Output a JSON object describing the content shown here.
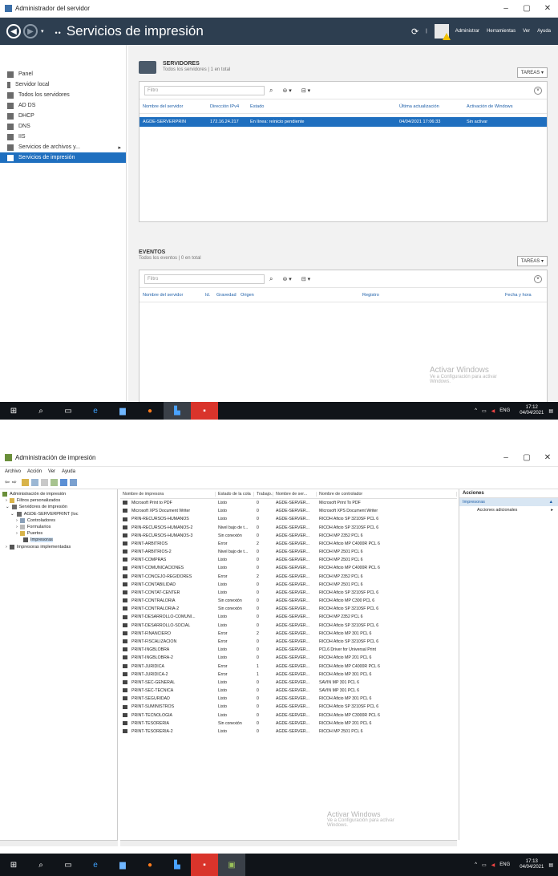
{
  "sm": {
    "window_title": "Administrador del servidor",
    "header_title": "Servicios de impresión",
    "menus": [
      "Administrar",
      "Herramientas",
      "Ver",
      "Ayuda"
    ],
    "sidebar": [
      {
        "label": "Panel",
        "selected": false
      },
      {
        "label": "Servidor local",
        "selected": false
      },
      {
        "label": "Todos los servidores",
        "selected": false
      },
      {
        "label": "AD DS",
        "selected": false
      },
      {
        "label": "DHCP",
        "selected": false
      },
      {
        "label": "DNS",
        "selected": false
      },
      {
        "label": "IIS",
        "selected": false
      },
      {
        "label": "Servicios de archivos y...",
        "selected": false,
        "arrow": "▸"
      },
      {
        "label": "Servicios de impresión",
        "selected": true
      }
    ],
    "servers": {
      "title": "SERVIDORES",
      "subtitle": "Todos los servidores | 1 en total",
      "tasks": "TAREAS",
      "filter_placeholder": "Filtro",
      "columns": [
        "Nombre del servidor",
        "Dirección IPv4",
        "Estado",
        "Última actualización",
        "Activación de Windows"
      ],
      "row": [
        "AGDE-SERVERPRIN",
        "172.16.24.217",
        "En línea: reinicio pendiente",
        "04/04/2021 17:06:33",
        "Sin activar"
      ]
    },
    "events": {
      "title": "EVENTOS",
      "subtitle": "Todos los eventos | 0 en total",
      "tasks": "TAREAS",
      "filter_placeholder": "Filtro",
      "columns": [
        "Nombre del servidor",
        "Id.",
        "Gravedad",
        "Origen",
        "Registro",
        "Fecha y hora"
      ]
    },
    "watermark": {
      "line1": "Activar Windows",
      "line2": "Ve a Configuración para activar",
      "line3": "Windows."
    }
  },
  "taskbar1": {
    "lang": "ENG",
    "time": "17:12",
    "date": "04/04/2021"
  },
  "pm": {
    "window_title": "Administración de impresión",
    "menus": [
      "Archivo",
      "Acción",
      "Ver",
      "Ayuda"
    ],
    "tree": [
      {
        "label": "Administración de impresión",
        "indent": 0
      },
      {
        "label": "Filtros personalizados",
        "indent": 1
      },
      {
        "label": "Servidores de impresión",
        "indent": 1
      },
      {
        "label": "AGDE-SERVERPRINT (loc",
        "indent": 2
      },
      {
        "label": "Controladores",
        "indent": 3
      },
      {
        "label": "Formularios",
        "indent": 3
      },
      {
        "label": "Puertos",
        "indent": 3
      },
      {
        "label": "Impresoras",
        "indent": 3,
        "selected": true
      },
      {
        "label": "Impresoras implementadas",
        "indent": 1
      }
    ],
    "columns": [
      "Nombre de impresora",
      "Estado de la cola",
      "Trabajo...",
      "Nombre de ser...",
      "Nombre de controlador"
    ],
    "printers": [
      [
        "Microsoft Print to PDF",
        "Listo",
        "0",
        "AGDE-SERVER...",
        "Microsoft Print To PDF"
      ],
      [
        "Microsoft XPS Document Writer",
        "Listo",
        "0",
        "AGDE-SERVER...",
        "Microsoft XPS Document Writer"
      ],
      [
        "PRIN-RECURSOS-HUMANOS",
        "Listo",
        "0",
        "AGDE-SERVER...",
        "RICOH Aficio SP 3210SF PCL 6"
      ],
      [
        "PRIN-RECURSOS-HUMANOS-2",
        "Nivel bajo de t...",
        "0",
        "AGDE-SERVER...",
        "RICOH Aficio SP 3210SF PCL 6"
      ],
      [
        "PRIN-RECURSOS-HUMANOS-3",
        "Sin conexión",
        "0",
        "AGDE-SERVER...",
        "RICOH MP 2352 PCL 6"
      ],
      [
        "PRINT-ARBITRIOS",
        "Error",
        "2",
        "AGDE-SERVER...",
        "RICOH Aficio MP C4000R PCL 6"
      ],
      [
        "PRINT-ARBITRIOS-2",
        "Nivel bajo de t...",
        "0",
        "AGDE-SERVER...",
        "RICOH MP 2501 PCL 6"
      ],
      [
        "PRINT-COMPRAS",
        "Listo",
        "0",
        "AGDE-SERVER...",
        "RICOH MP 2501 PCL 6"
      ],
      [
        "PRINT-COMUNICACIONES",
        "Listo",
        "0",
        "AGDE-SERVER...",
        "RICOH Aficio MP C4000R PCL 6"
      ],
      [
        "PRINT-CONCEJO-REGIDORES",
        "Error",
        "2",
        "AGDE-SERVER...",
        "RICOH MP 2352 PCL 6"
      ],
      [
        "PRINT-CONTABILIDAD",
        "Listo",
        "0",
        "AGDE-SERVER...",
        "RICOH MP 2501 PCL 6"
      ],
      [
        "PRINT-CONTAT-CENTER",
        "Listo",
        "0",
        "AGDE-SERVER...",
        "RICOH Aficio SP 3210SF PCL 6"
      ],
      [
        "PRINT-CONTRALORIA",
        "Sin conexión",
        "0",
        "AGDE-SERVER...",
        "RICOH Aficio MP C300 PCL 6"
      ],
      [
        "PRINT-CONTRALORIA-2",
        "Sin conexión",
        "0",
        "AGDE-SERVER...",
        "RICOH Aficio SP 3210SF PCL 6"
      ],
      [
        "PRINT-DESARROLLO-COMUNI...",
        "Listo",
        "0",
        "AGDE-SERVER...",
        "RICOH MP 2352 PCL 6"
      ],
      [
        "PRINT-DESARROLLO-SOCIAL",
        "Listo",
        "0",
        "AGDE-SERVER...",
        "RICOH Aficio SP 3210SF PCL 6"
      ],
      [
        "PRINT-FINANCIERO",
        "Error",
        "2",
        "AGDE-SERVER...",
        "RICOH Aficio MP 301 PCL 6"
      ],
      [
        "PRINT-FISCALIZACION",
        "Error",
        "0",
        "AGDE-SERVER...",
        "RICOH Aficio SP 3210SF PCL 6"
      ],
      [
        "PRINT-INGBLOBRA",
        "Listo",
        "0",
        "AGDE-SERVER...",
        "PCL6 Driver for Universal Print"
      ],
      [
        "PRINT-INGBLOBRA-2",
        "Listo",
        "0",
        "AGDE-SERVER...",
        "RICOH Aficio MP 201 PCL 6"
      ],
      [
        "PRINT-JURIDICA",
        "Error",
        "1",
        "AGDE-SERVER...",
        "RICOH Aficio MP C4000R PCL 6"
      ],
      [
        "PRINT-JURIDICA-2",
        "Error",
        "1",
        "AGDE-SERVER...",
        "RICOH Aficio MP 301 PCL 6"
      ],
      [
        "PRINT-SEC-GENERAL",
        "Listo",
        "0",
        "AGDE-SERVER...",
        "SAVIN MP 301 PCL 6"
      ],
      [
        "PRINT-SEC-TECNICA",
        "Listo",
        "0",
        "AGDE-SERVER...",
        "SAVIN MP 301 PCL 6"
      ],
      [
        "PRINT-SEGURIDAD",
        "Listo",
        "0",
        "AGDE-SERVER...",
        "RICOH Aficio MP 301 PCL 6"
      ],
      [
        "PRINT-SUMINISTROS",
        "Listo",
        "0",
        "AGDE-SERVER...",
        "RICOH Aficio SP 3210SF PCL 6"
      ],
      [
        "PRINT-TECNOLOGIA",
        "Listo",
        "0",
        "AGDE-SERVER...",
        "RICOH Aficio MP C3000R PCL 6"
      ],
      [
        "PRINT-TESORERIA",
        "Sin conexión",
        "0",
        "AGDE-SERVER...",
        "RICOH Aficio MP 201 PCL 6"
      ],
      [
        "PRINT-TESORERIA-2",
        "Listo",
        "0",
        "AGDE-SERVER...",
        "RICOH MP 2501 PCL 6"
      ]
    ],
    "actions": {
      "title": "Acciones",
      "group": "Impresoras",
      "item": "Acciones adicionales"
    },
    "watermark": {
      "line1": "Activar Windows",
      "line2": "Ve a Configuración para activar",
      "line3": "Windows."
    }
  },
  "taskbar2": {
    "lang": "ENG",
    "time": "17:13",
    "date": "04/04/2021"
  }
}
